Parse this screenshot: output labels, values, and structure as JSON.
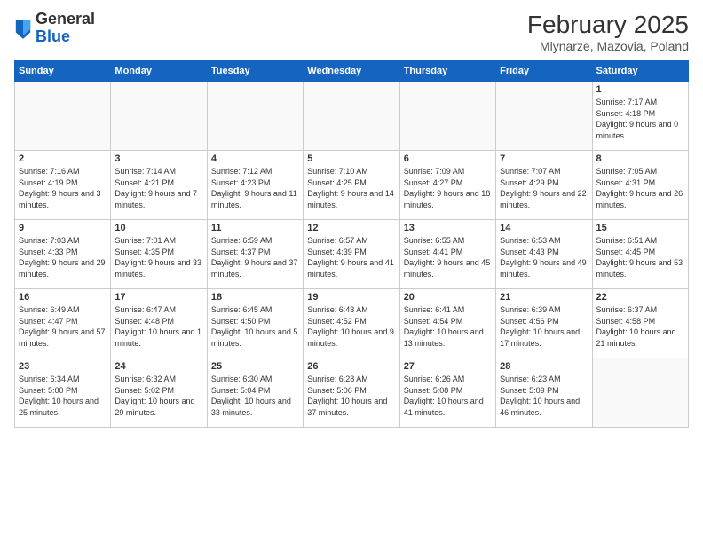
{
  "header": {
    "logo_general": "General",
    "logo_blue": "Blue",
    "month_title": "February 2025",
    "location": "Mlynarze, Mazovia, Poland"
  },
  "days_of_week": [
    "Sunday",
    "Monday",
    "Tuesday",
    "Wednesday",
    "Thursday",
    "Friday",
    "Saturday"
  ],
  "weeks": [
    [
      {
        "day": "",
        "info": ""
      },
      {
        "day": "",
        "info": ""
      },
      {
        "day": "",
        "info": ""
      },
      {
        "day": "",
        "info": ""
      },
      {
        "day": "",
        "info": ""
      },
      {
        "day": "",
        "info": ""
      },
      {
        "day": "1",
        "info": "Sunrise: 7:17 AM\nSunset: 4:18 PM\nDaylight: 9 hours and 0 minutes."
      }
    ],
    [
      {
        "day": "2",
        "info": "Sunrise: 7:16 AM\nSunset: 4:19 PM\nDaylight: 9 hours and 3 minutes."
      },
      {
        "day": "3",
        "info": "Sunrise: 7:14 AM\nSunset: 4:21 PM\nDaylight: 9 hours and 7 minutes."
      },
      {
        "day": "4",
        "info": "Sunrise: 7:12 AM\nSunset: 4:23 PM\nDaylight: 9 hours and 11 minutes."
      },
      {
        "day": "5",
        "info": "Sunrise: 7:10 AM\nSunset: 4:25 PM\nDaylight: 9 hours and 14 minutes."
      },
      {
        "day": "6",
        "info": "Sunrise: 7:09 AM\nSunset: 4:27 PM\nDaylight: 9 hours and 18 minutes."
      },
      {
        "day": "7",
        "info": "Sunrise: 7:07 AM\nSunset: 4:29 PM\nDaylight: 9 hours and 22 minutes."
      },
      {
        "day": "8",
        "info": "Sunrise: 7:05 AM\nSunset: 4:31 PM\nDaylight: 9 hours and 26 minutes."
      }
    ],
    [
      {
        "day": "9",
        "info": "Sunrise: 7:03 AM\nSunset: 4:33 PM\nDaylight: 9 hours and 29 minutes."
      },
      {
        "day": "10",
        "info": "Sunrise: 7:01 AM\nSunset: 4:35 PM\nDaylight: 9 hours and 33 minutes."
      },
      {
        "day": "11",
        "info": "Sunrise: 6:59 AM\nSunset: 4:37 PM\nDaylight: 9 hours and 37 minutes."
      },
      {
        "day": "12",
        "info": "Sunrise: 6:57 AM\nSunset: 4:39 PM\nDaylight: 9 hours and 41 minutes."
      },
      {
        "day": "13",
        "info": "Sunrise: 6:55 AM\nSunset: 4:41 PM\nDaylight: 9 hours and 45 minutes."
      },
      {
        "day": "14",
        "info": "Sunrise: 6:53 AM\nSunset: 4:43 PM\nDaylight: 9 hours and 49 minutes."
      },
      {
        "day": "15",
        "info": "Sunrise: 6:51 AM\nSunset: 4:45 PM\nDaylight: 9 hours and 53 minutes."
      }
    ],
    [
      {
        "day": "16",
        "info": "Sunrise: 6:49 AM\nSunset: 4:47 PM\nDaylight: 9 hours and 57 minutes."
      },
      {
        "day": "17",
        "info": "Sunrise: 6:47 AM\nSunset: 4:48 PM\nDaylight: 10 hours and 1 minute."
      },
      {
        "day": "18",
        "info": "Sunrise: 6:45 AM\nSunset: 4:50 PM\nDaylight: 10 hours and 5 minutes."
      },
      {
        "day": "19",
        "info": "Sunrise: 6:43 AM\nSunset: 4:52 PM\nDaylight: 10 hours and 9 minutes."
      },
      {
        "day": "20",
        "info": "Sunrise: 6:41 AM\nSunset: 4:54 PM\nDaylight: 10 hours and 13 minutes."
      },
      {
        "day": "21",
        "info": "Sunrise: 6:39 AM\nSunset: 4:56 PM\nDaylight: 10 hours and 17 minutes."
      },
      {
        "day": "22",
        "info": "Sunrise: 6:37 AM\nSunset: 4:58 PM\nDaylight: 10 hours and 21 minutes."
      }
    ],
    [
      {
        "day": "23",
        "info": "Sunrise: 6:34 AM\nSunset: 5:00 PM\nDaylight: 10 hours and 25 minutes."
      },
      {
        "day": "24",
        "info": "Sunrise: 6:32 AM\nSunset: 5:02 PM\nDaylight: 10 hours and 29 minutes."
      },
      {
        "day": "25",
        "info": "Sunrise: 6:30 AM\nSunset: 5:04 PM\nDaylight: 10 hours and 33 minutes."
      },
      {
        "day": "26",
        "info": "Sunrise: 6:28 AM\nSunset: 5:06 PM\nDaylight: 10 hours and 37 minutes."
      },
      {
        "day": "27",
        "info": "Sunrise: 6:26 AM\nSunset: 5:08 PM\nDaylight: 10 hours and 41 minutes."
      },
      {
        "day": "28",
        "info": "Sunrise: 6:23 AM\nSunset: 5:09 PM\nDaylight: 10 hours and 46 minutes."
      },
      {
        "day": "",
        "info": ""
      }
    ]
  ]
}
